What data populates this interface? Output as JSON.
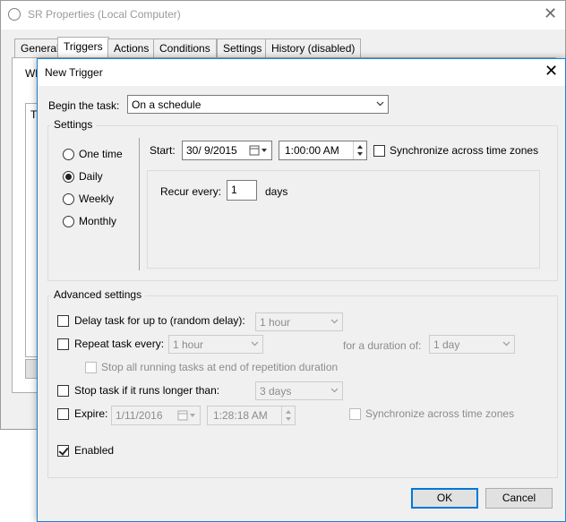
{
  "background_window": {
    "title": "SR Properties (Local Computer)",
    "tabs": [
      "General",
      "Triggers",
      "Actions",
      "Conditions",
      "Settings",
      "History (disabled)"
    ],
    "partial_text": "Wh",
    "partial_list_text": "T"
  },
  "dialog": {
    "title": "New Trigger",
    "begin_label": "Begin the task:",
    "begin_value": "On a schedule",
    "settings": {
      "title": "Settings",
      "options": [
        "One time",
        "Daily",
        "Weekly",
        "Monthly"
      ],
      "selected": "Daily",
      "start_label": "Start:",
      "start_date": "30/ 9/2015",
      "start_time": "1:00:00 AM",
      "sync_label": "Synchronize across time zones",
      "recur_label": "Recur every:",
      "recur_value": "1",
      "recur_unit": "days"
    },
    "advanced": {
      "title": "Advanced settings",
      "delay_label": "Delay task for up to (random delay):",
      "delay_value": "1 hour",
      "repeat_label": "Repeat task every:",
      "repeat_value": "1 hour",
      "duration_label": "for a duration of:",
      "duration_value": "1 day",
      "stop_running_label": "Stop all running tasks at end of repetition duration",
      "stop_longer_label": "Stop task if it runs longer than:",
      "stop_longer_value": "3 days",
      "expire_label": "Expire:",
      "expire_date": "1/11/2016",
      "expire_time": "1:28:18 AM",
      "expire_sync_label": "Synchronize across time zones",
      "enabled_label": "Enabled",
      "enabled_checked": true
    },
    "ok_label": "OK",
    "cancel_label": "Cancel"
  }
}
